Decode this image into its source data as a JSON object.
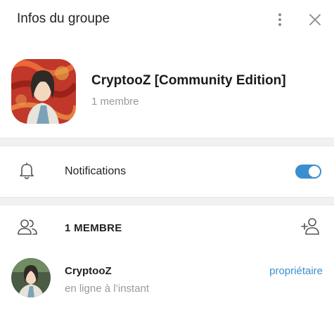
{
  "header": {
    "title": "Infos du groupe",
    "more_icon": "more-vertical-icon",
    "close_icon": "close-icon"
  },
  "group": {
    "name": "CryptooZ [Community Edition]",
    "members_label": "1 membre"
  },
  "notifications": {
    "label": "Notifications",
    "enabled": true,
    "icon": "bell-icon"
  },
  "members": {
    "title": "1 MEMBRE",
    "icon": "people-icon",
    "add_icon": "add-user-icon",
    "list": [
      {
        "name": "CryptooZ",
        "status": "en ligne à l’instant",
        "role": "propriétaire"
      }
    ]
  },
  "colors": {
    "accent": "#3a8fd0",
    "icon_gray": "#8a8a8a",
    "muted_text": "#999999",
    "divider_bg": "#f1f1f1"
  }
}
